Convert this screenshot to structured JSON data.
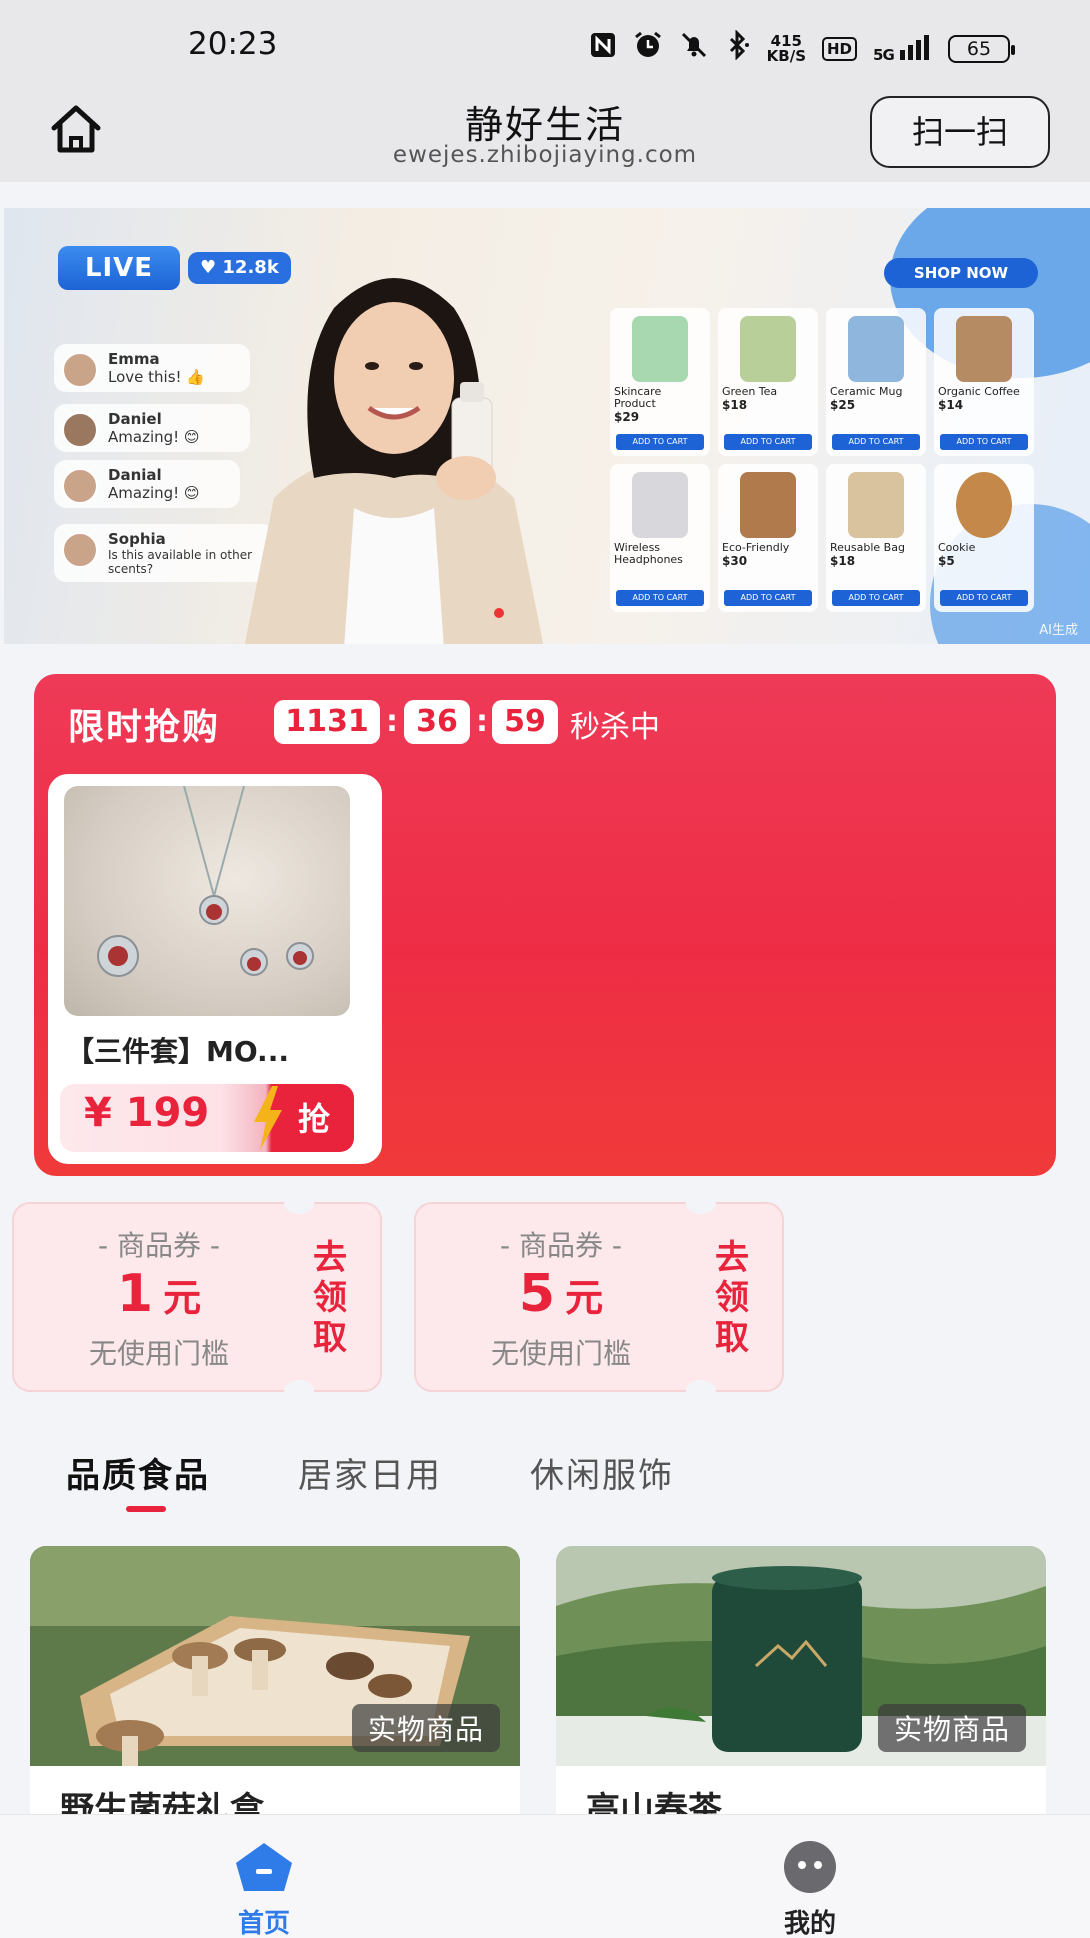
{
  "status_bar": {
    "time": "20:23",
    "net_speed_top": "415",
    "net_speed_unit": "KB/S",
    "hd": "HD",
    "signal": "5G",
    "battery": "65"
  },
  "header": {
    "title": "静好生活",
    "url": "ewejes.zhibojiaying.com",
    "scan_label": "扫一扫",
    "home_icon": "home-icon"
  },
  "banner": {
    "live_label": "LIVE",
    "likes": "12.8k",
    "shop_now": "SHOP NOW",
    "ai_mark": "AI生成",
    "comments": [
      {
        "name": "Emma",
        "text": "Love this! 👍"
      },
      {
        "name": "Daniel",
        "text": "Amazing! 😊"
      },
      {
        "name": "Danial",
        "text": "Amazing! 😊"
      },
      {
        "name": "Sophia",
        "text": "Is this available in other scents?"
      }
    ],
    "products": [
      {
        "name": "Skincare Product",
        "price": "$29",
        "cta": "ADD TO CART",
        "color": "#a8d8b0"
      },
      {
        "name": "Green Tea",
        "price": "$18",
        "cta": "ADD TO CART",
        "color": "#b9cf9a"
      },
      {
        "name": "Ceramic Mug",
        "price": "$25",
        "cta": "ADD TO CART",
        "color": "#8fb7de"
      },
      {
        "name": "Organic Coffee",
        "price": "$14",
        "cta": "ADD TO CART",
        "color": "#b58b63"
      },
      {
        "name": "Wireless Headphones",
        "price": "",
        "cta": "ADD TO CART",
        "color": "#d8d8dc"
      },
      {
        "name": "Eco-Friendly",
        "price": "$30",
        "cta": "ADD TO CART",
        "color": "#b07a4c"
      },
      {
        "name": "Reusable Bag",
        "price": "$18",
        "cta": "ADD TO CART",
        "color": "#d9c39e"
      },
      {
        "name": "Cookie",
        "price": "$5",
        "cta": "ADD TO CART",
        "color": "#c4884a"
      }
    ]
  },
  "flash_sale": {
    "title": "限时抢购",
    "countdown": {
      "hours": "1131",
      "minutes": "36",
      "seconds": "59"
    },
    "status": "秒杀中",
    "item": {
      "name": "【三件套】MO...",
      "price": "¥ 199",
      "grab_label": "抢"
    }
  },
  "coupons": [
    {
      "label": "- 商品券 -",
      "amount": "1",
      "unit": "元",
      "condition": "无使用门槛",
      "claim": "去领取"
    },
    {
      "label": "- 商品券 -",
      "amount": "5",
      "unit": "元",
      "condition": "无使用门槛",
      "claim": "去领取"
    }
  ],
  "tabs": [
    {
      "label": "品质食品",
      "active": true
    },
    {
      "label": "居家日用",
      "active": false
    },
    {
      "label": "休闲服饰",
      "active": false
    }
  ],
  "products": [
    {
      "tag": "实物商品",
      "title": "野生菌菇礼盒"
    },
    {
      "tag": "实物商品",
      "title": "高山春茶"
    }
  ],
  "bottom_nav": [
    {
      "label": "首页",
      "icon": "home-icon",
      "active": true,
      "color": "#2f7be8"
    },
    {
      "label": "我的",
      "icon": "profile-icon",
      "active": false,
      "color": "#222"
    }
  ]
}
